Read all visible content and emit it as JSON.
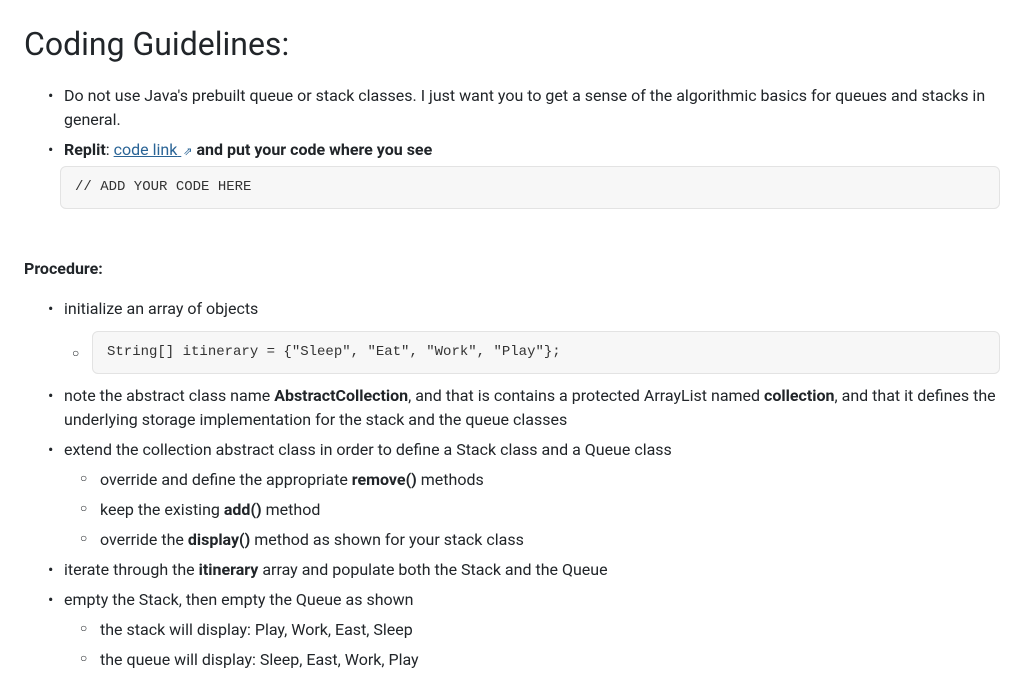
{
  "heading": "Coding Guidelines:",
  "guidelines": {
    "item1": "Do not use Java's prebuilt queue or stack classes.  I just want you to get a sense of the algorithmic basics for queues and stacks in general.",
    "item2_prefix": "Replit",
    "item2_link": "code link",
    "item2_suffix": " and put your code where you see",
    "code1": "// ADD YOUR CODE HERE"
  },
  "procedure_heading_prefix": "Procedure",
  "procedure": {
    "item1": "initialize an array of objects",
    "code2": "String[] itinerary = {\"Sleep\", \"Eat\", \"Work\", \"Play\"};",
    "item2_a": "note the abstract class name ",
    "item2_b": "AbstractCollection",
    "item2_c": ", and that is contains a protected ArrayList named ",
    "item2_d": "collection",
    "item2_e": ", and that it defines the underlying storage implementation for the stack and the queue classes",
    "item3": "extend the collection abstract class in order to define a Stack class and a Queue class",
    "item3_sub1_a": "override and define the appropriate ",
    "item3_sub1_b": "remove()",
    "item3_sub1_c": " methods",
    "item3_sub2_a": "keep the existing ",
    "item3_sub2_b": "add()",
    "item3_sub2_c": " method",
    "item3_sub3_a": "override the ",
    "item3_sub3_b": "display()",
    "item3_sub3_c": " method as shown for your stack class",
    "item4_a": "iterate through the ",
    "item4_b": "itinerary",
    "item4_c": " array and populate both the Stack and the Queue",
    "item5": "empty the Stack, then empty the Queue as shown",
    "item5_sub1": "the stack will display: Play, Work, East, Sleep",
    "item5_sub2": "the queue will display: Sleep, East, Work, Play"
  }
}
